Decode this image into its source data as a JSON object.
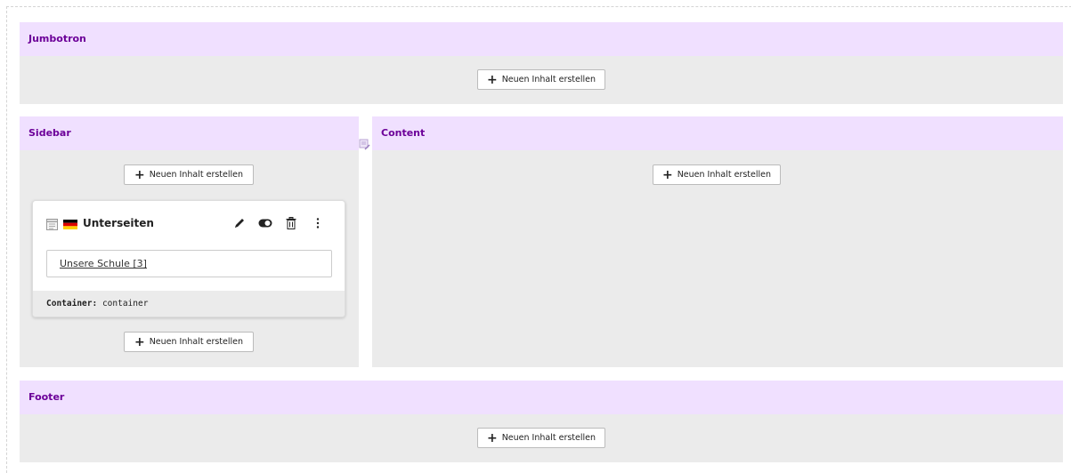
{
  "sections": {
    "jumbotron": {
      "title": "Jumbotron",
      "button": "Neuen Inhalt erstellen"
    },
    "sidebar": {
      "title": "Sidebar",
      "button_top": "Neuen Inhalt erstellen",
      "button_bottom": "Neuen Inhalt erstellen"
    },
    "content": {
      "title": "Content",
      "button": "Neuen Inhalt erstellen"
    },
    "footer": {
      "title": "Footer",
      "button": "Neuen Inhalt erstellen"
    }
  },
  "card": {
    "title": "Unterseiten",
    "link": "Unsere Schule [3]",
    "footer_label": "Container:",
    "footer_value": "container"
  },
  "icons": {
    "content-type": "page-list-icon",
    "language": "german-flag-icon",
    "edit": "pencil-icon",
    "toggle": "toggle-visibility-icon",
    "delete": "trash-icon",
    "more": "more-vertical-icon",
    "drag": "drag-handle-icon"
  },
  "colors": {
    "header_bg": "#f0e0ff",
    "header_text": "#6c0099",
    "column_bg": "#ebebeb"
  }
}
